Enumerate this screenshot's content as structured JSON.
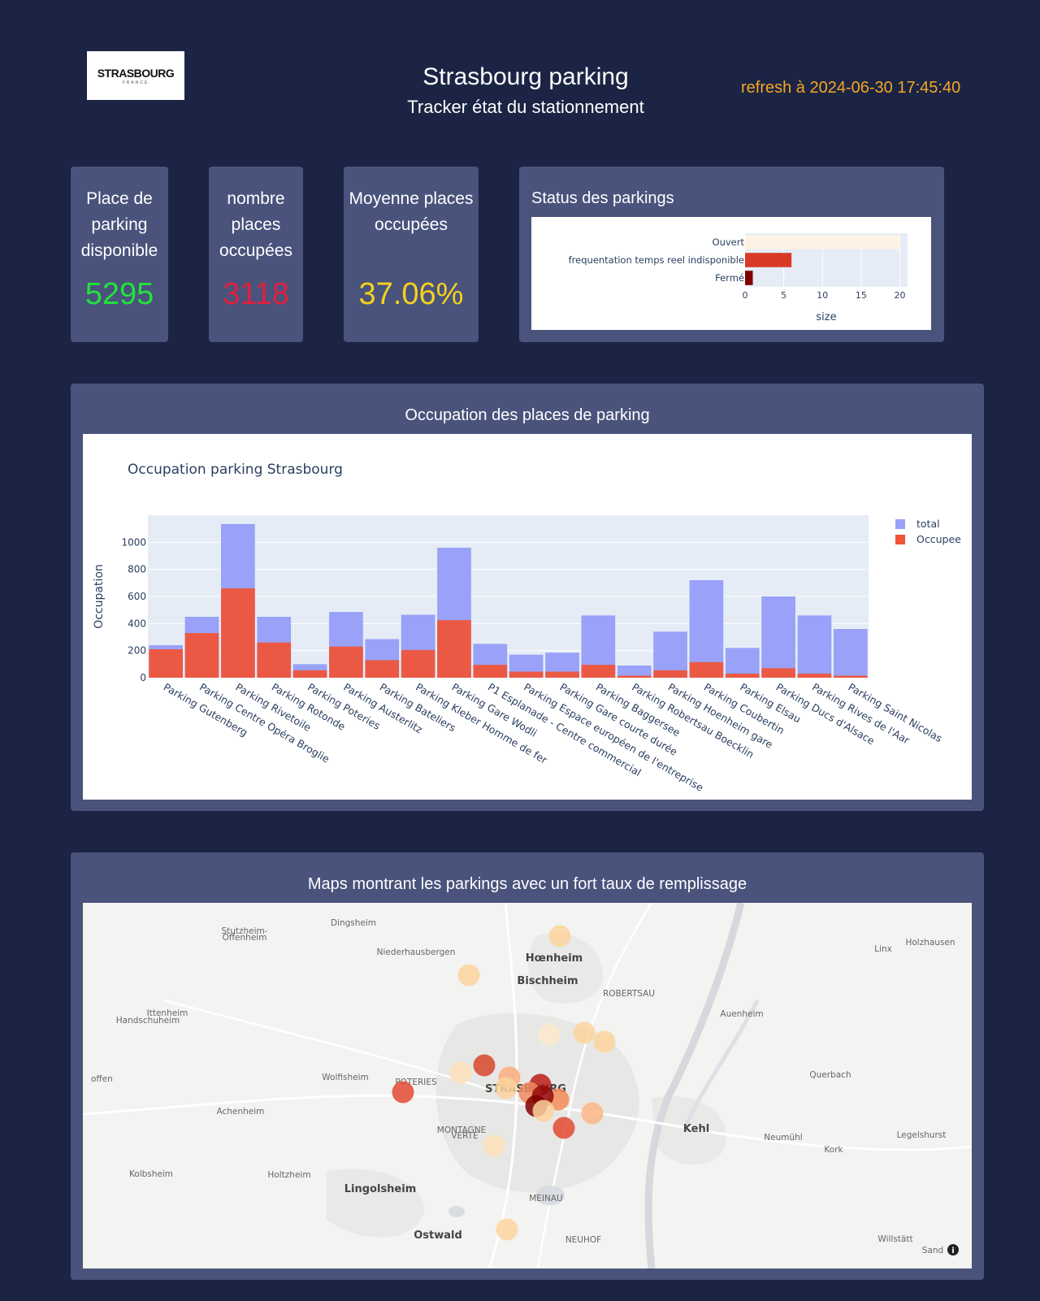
{
  "header": {
    "logo_text": "STRASBOURG",
    "logo_sub": "FRANCE",
    "title": "Strasbourg parking",
    "subtitle": "Tracker état du stationnement",
    "refresh": "refresh à 2024-06-30 17:45:40"
  },
  "kpis": {
    "available": {
      "label": "Place de parking disponible",
      "value": "5295",
      "color": "#22e33b"
    },
    "occupied": {
      "label": "nombre places occupées",
      "value": "3118",
      "color": "#e0203d"
    },
    "average": {
      "label": "Moyenne places occupées",
      "value": "37.06%",
      "color": "#f5d11c"
    }
  },
  "status_panel": {
    "title": "Status des parkings",
    "chart_data": {
      "type": "bar",
      "orientation": "horizontal",
      "categories": [
        "Ouvert",
        "frequentation temps reel indisponible",
        "Fermé"
      ],
      "values": [
        20,
        6,
        1
      ],
      "colors": [
        "#fdf3e5",
        "#d83a26",
        "#7f0000"
      ],
      "xlabel": "size",
      "xticks": [
        "0",
        "5",
        "10",
        "15",
        "20"
      ],
      "xlim": [
        0,
        21
      ]
    }
  },
  "occupation_panel": {
    "title": "Occupation des places de parking",
    "chart_data": {
      "type": "bar",
      "barmode": "overlay",
      "title": "Occupation parking Strasbourg",
      "ylabel": "Occupation",
      "ylim": [
        0,
        1200
      ],
      "yticks": [
        "0",
        "200",
        "400",
        "600",
        "800",
        "1000"
      ],
      "categories": [
        "Parking Gutenberg",
        "Parking Centre Opéra Broglie",
        "Parking Rivetoile",
        "Parking Rotonde",
        "Parking Poteries",
        "Parking Austerlitz",
        "Parking Bateliers",
        "Parking Kleber Homme de fer",
        "Parking Gare Wodli",
        "P1 Esplanade - Centre commercial",
        "Parking Espace européen de l'entreprise",
        "Parking Gare courte durée",
        "Parking Baggersee",
        "Parking Robertsau Boecklin",
        "Parking Hoenheim gare",
        "Parking Coubertin",
        "Parking Elsau",
        "Parking Ducs d'Alsace",
        "Parking Rives de l'Aar",
        "Parking Saint Nicolas"
      ],
      "series": [
        {
          "name": "total",
          "color": "#99a2f8",
          "values": [
            240,
            450,
            1135,
            450,
            100,
            485,
            285,
            465,
            960,
            250,
            170,
            185,
            460,
            90,
            340,
            720,
            220,
            600,
            460,
            360
          ]
        },
        {
          "name": "Occupee",
          "color": "#ef553b",
          "values": [
            210,
            330,
            660,
            260,
            55,
            230,
            130,
            205,
            425,
            95,
            45,
            45,
            95,
            15,
            55,
            115,
            30,
            70,
            30,
            15
          ]
        }
      ]
    }
  },
  "map_panel": {
    "title": "Maps montrant les parkings avec un fort taux de remplissage",
    "place_labels": [
      {
        "text": "Dingsheim",
        "bold": false
      },
      {
        "text": "Stutzheim-",
        "bold": false
      },
      {
        "text": "Offenheim",
        "bold": false
      },
      {
        "text": "Niederhausbergen",
        "bold": false
      },
      {
        "text": "Hœnheim",
        "bold": true
      },
      {
        "text": "Bischheim",
        "bold": true
      },
      {
        "text": "ROBERTSAU",
        "bold": false
      },
      {
        "text": "Linx",
        "bold": false
      },
      {
        "text": "Holzhausen",
        "bold": false
      },
      {
        "text": "Ittenheim",
        "bold": false
      },
      {
        "text": "Handschuheim",
        "bold": false
      },
      {
        "text": "Auenheim",
        "bold": false
      },
      {
        "text": "offen",
        "bold": false
      },
      {
        "text": "Wolfisheim",
        "bold": false
      },
      {
        "text": "POTERIES",
        "bold": false
      },
      {
        "text": "STRASBOURG",
        "bold": true
      },
      {
        "text": "Querbach",
        "bold": false
      },
      {
        "text": "Achenheim",
        "bold": false
      },
      {
        "text": "Kehl",
        "bold": true
      },
      {
        "text": "MONTAGNE",
        "bold": false
      },
      {
        "text": "VERTE",
        "bold": false
      },
      {
        "text": "Neumühl",
        "bold": false
      },
      {
        "text": "Legelshurst",
        "bold": false
      },
      {
        "text": "Kork",
        "bold": false
      },
      {
        "text": "Kolbsheim",
        "bold": false
      },
      {
        "text": "Holtzheim",
        "bold": false
      },
      {
        "text": "Lingolsheim",
        "bold": true
      },
      {
        "text": "MEINAU",
        "bold": false
      },
      {
        "text": "Ostwald",
        "bold": true
      },
      {
        "text": "NEUHOF",
        "bold": false
      },
      {
        "text": "Willstätt",
        "bold": false
      },
      {
        "text": "Sand",
        "bold": false
      }
    ],
    "info_icon": "info-icon"
  }
}
